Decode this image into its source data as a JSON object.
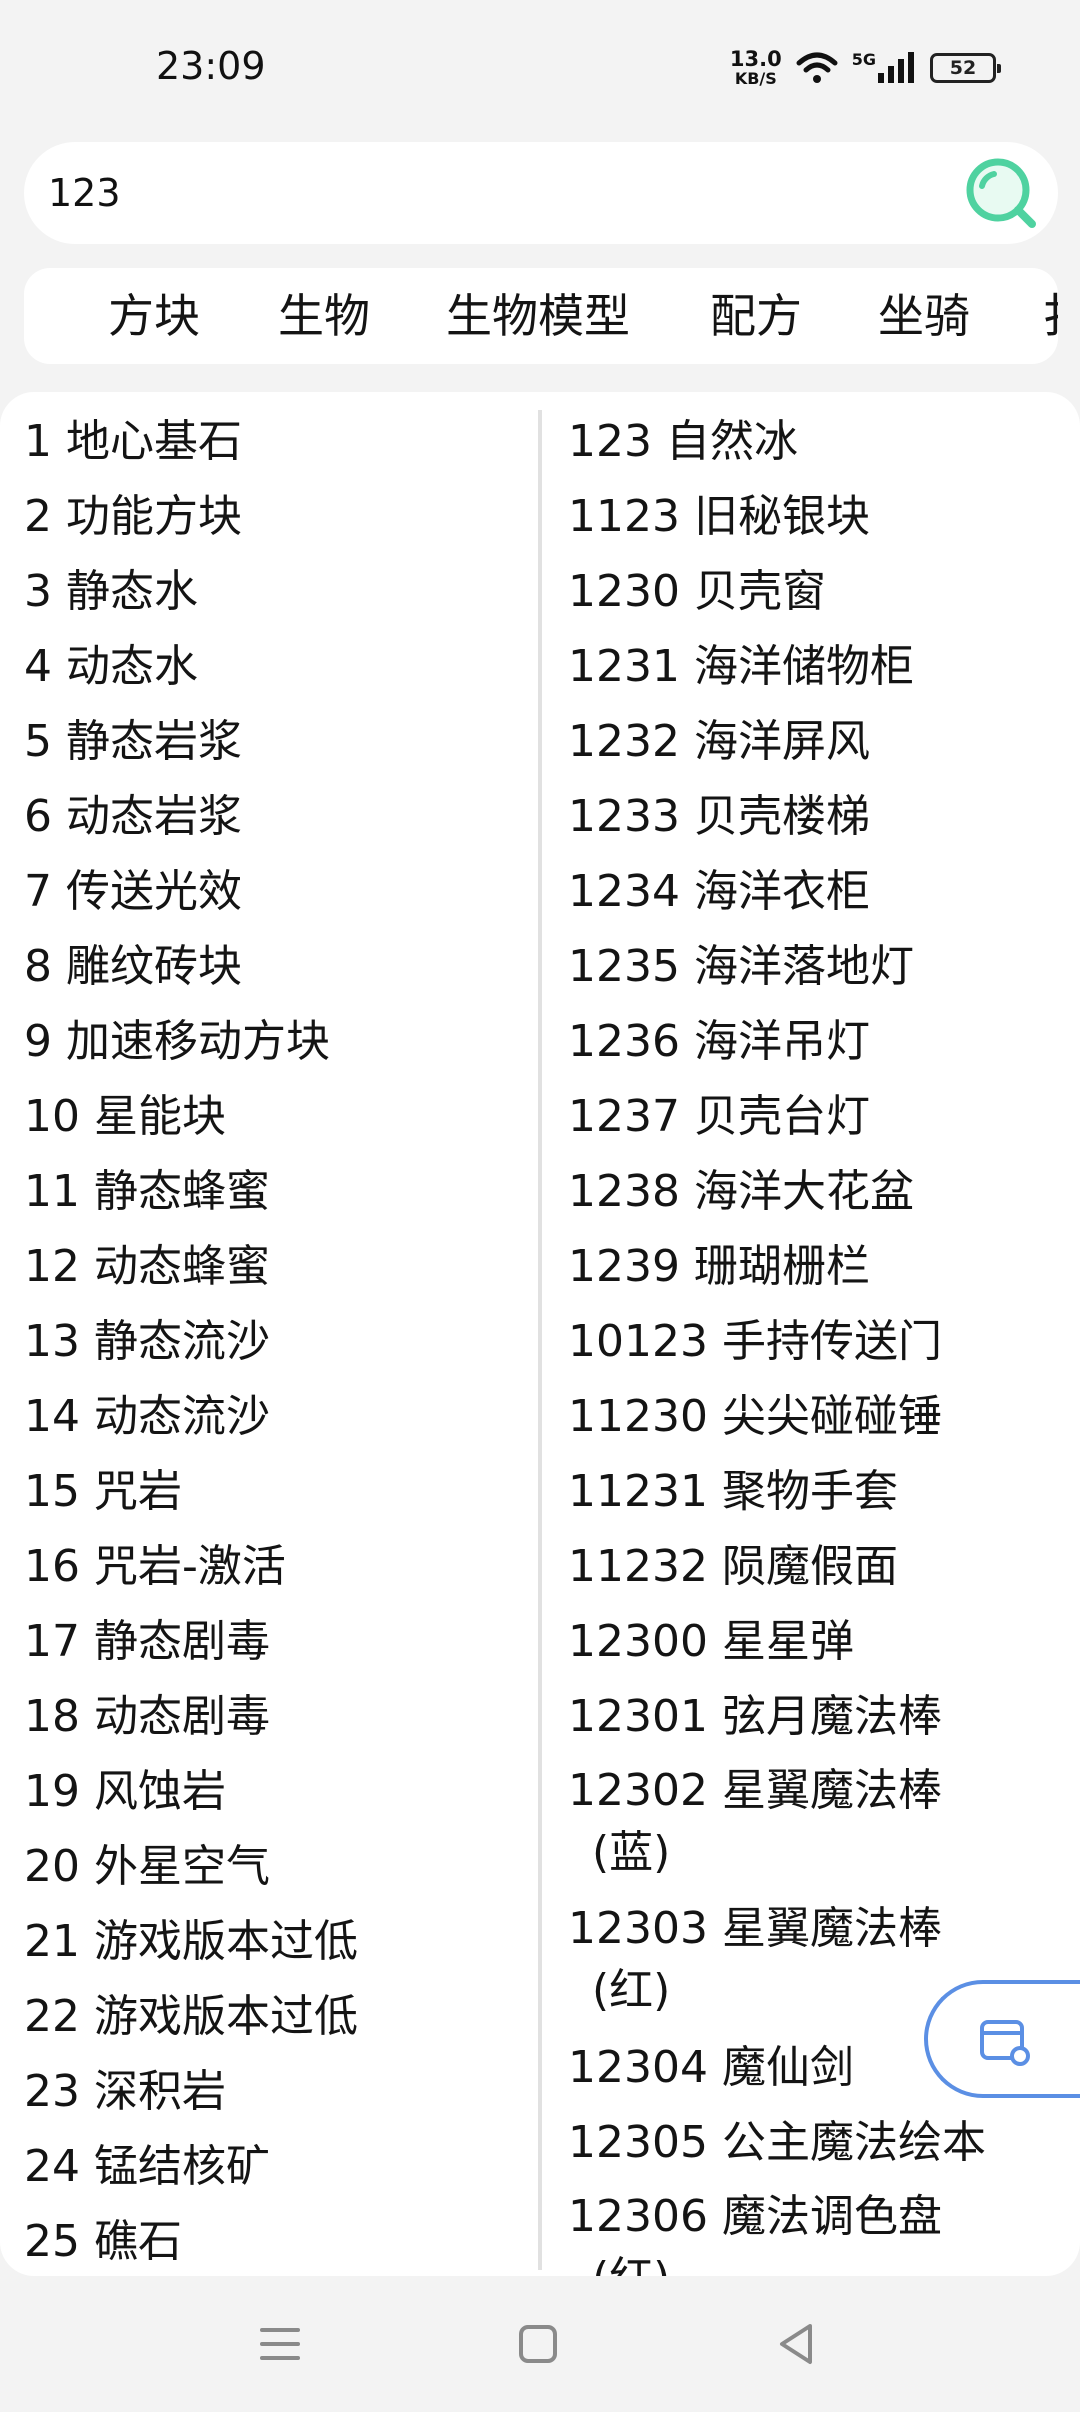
{
  "status_bar": {
    "time": "23:09",
    "net_speed_value": "13.0",
    "net_speed_unit": "KB/S",
    "network": "5G",
    "battery": "52",
    "icons": [
      "wifi-icon",
      "signal-icon",
      "battery-icon"
    ]
  },
  "search": {
    "value": "123",
    "placeholder": "",
    "accent_color": "#4fd2a0"
  },
  "tabs": [
    {
      "label": "方块"
    },
    {
      "label": "生物"
    },
    {
      "label": "生物模型"
    },
    {
      "label": "配方"
    },
    {
      "label": "坐骑"
    },
    {
      "label": "扌"
    }
  ],
  "results": {
    "left": [
      "1 地心基石",
      "2 功能方块",
      "3 静态水",
      "4 动态水",
      "5 静态岩浆",
      "6 动态岩浆",
      "7 传送光效",
      "8 雕纹砖块",
      "9 加速移动方块",
      "10 星能块",
      "11 静态蜂蜜",
      "12 动态蜂蜜",
      "13 静态流沙",
      "14 动态流沙",
      "15 咒岩",
      "16 咒岩-激活",
      "17 静态剧毒",
      "18 动态剧毒",
      "19 风蚀岩",
      "20 外星空气",
      "21 游戏版本过低",
      "22 游戏版本过低",
      "23 深积岩",
      "24 锰结核矿",
      "25 礁石"
    ],
    "right": [
      "123 自然冰",
      "1123 旧秘银块",
      "1230 贝壳窗",
      "1231 海洋储物柜",
      "1232 海洋屏风",
      "1233 贝壳楼梯",
      "1234 海洋衣柜",
      "1235 海洋落地灯",
      "1236 海洋吊灯",
      "1237 贝壳台灯",
      "1238 海洋大花盆",
      "1239 珊瑚栅栏",
      "10123 手持传送门",
      "11230 尖尖碰碰锤",
      "11231 聚物手套",
      "11232 陨魔假面",
      "12300 星星弹",
      "12301 弦月魔法棒"
    ],
    "right_wrapped": [
      {
        "main": "12302 星翼魔法棒",
        "sub": "(蓝)"
      },
      {
        "main": "12303 星翼魔法棒",
        "sub": "(红)"
      }
    ],
    "right_tail": [
      "12304 魔仙剑",
      "12305 公主魔法绘本"
    ],
    "right_last": {
      "main": "12306 魔法调色盘",
      "sub": "(红)"
    }
  },
  "floating_button": {
    "icon": "card-settings-icon",
    "border_color": "#5b8fe4"
  },
  "nav_bar": {
    "icons": [
      "menu-icon",
      "home-icon",
      "back-icon"
    ]
  }
}
